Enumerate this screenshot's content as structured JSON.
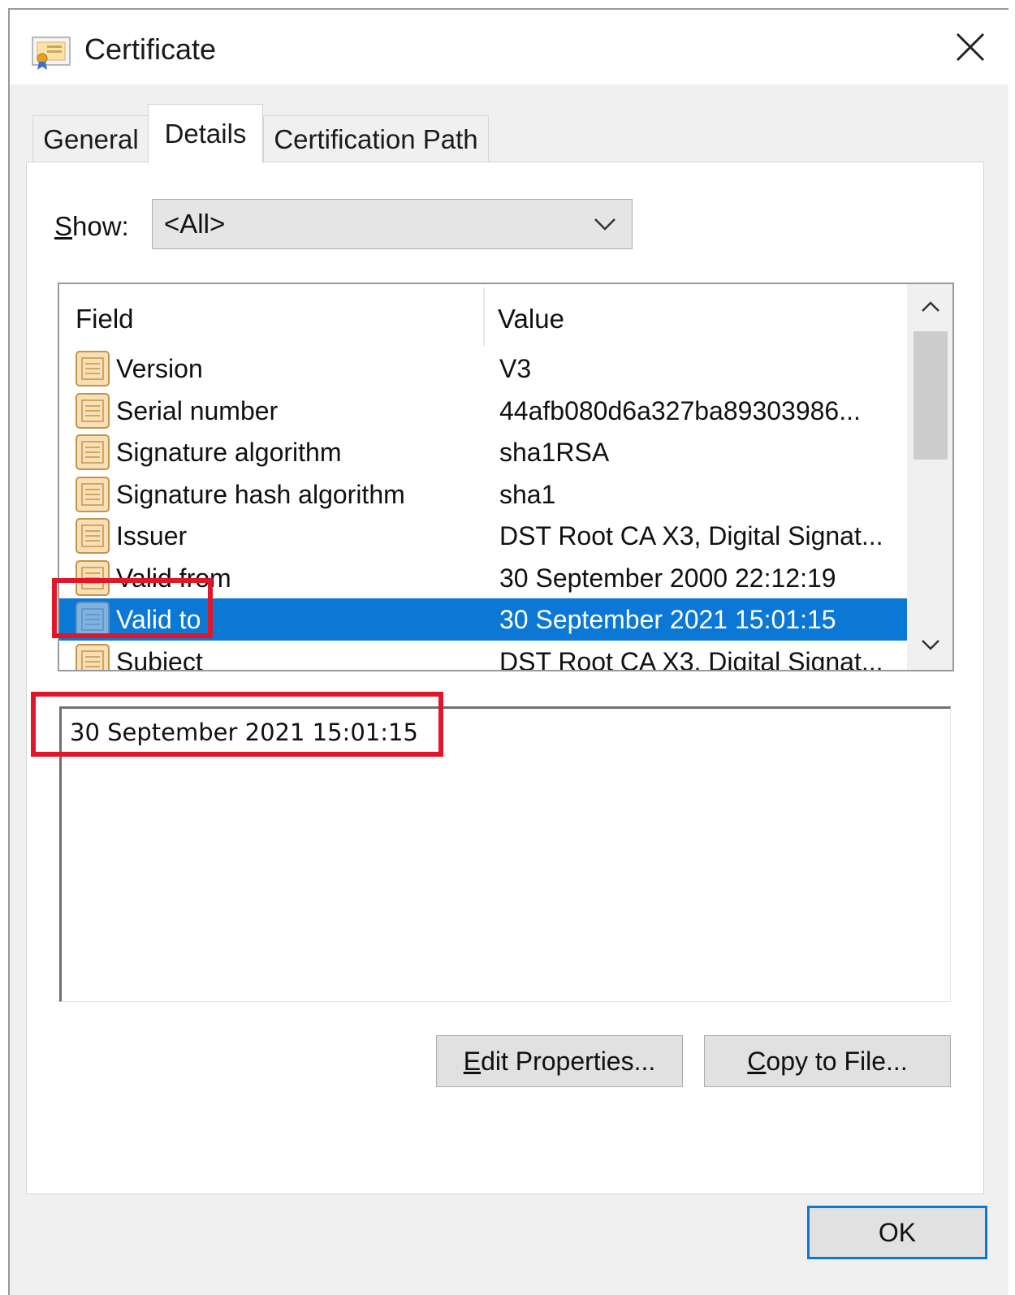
{
  "window": {
    "title": "Certificate",
    "icon": "certificate-icon",
    "close_icon": "close-icon"
  },
  "tabs": [
    {
      "label": "General",
      "active": false
    },
    {
      "label": "Details",
      "active": true
    },
    {
      "label": "Certification Path",
      "active": false
    }
  ],
  "show": {
    "label_accel": "S",
    "label_rest": "how:",
    "selected": "<All>"
  },
  "list": {
    "columns": {
      "field": "Field",
      "value": "Value"
    },
    "rows": [
      {
        "field": "Version",
        "value": "V3"
      },
      {
        "field": "Serial number",
        "value": "44afb080d6a327ba89303986..."
      },
      {
        "field": "Signature algorithm",
        "value": "sha1RSA"
      },
      {
        "field": "Signature hash algorithm",
        "value": "sha1"
      },
      {
        "field": "Issuer",
        "value": "DST Root CA X3, Digital Signat..."
      },
      {
        "field": "Valid from",
        "value": "30 September 2000 22:12:19"
      },
      {
        "field": "Valid to",
        "value": "30 September 2021 15:01:15"
      },
      {
        "field": "Subject",
        "value": "DST Root CA X3, Digital Signat..."
      }
    ],
    "selected_index": 6
  },
  "detail": {
    "text": "30 September 2021 15:01:15"
  },
  "buttons": {
    "edit_accel": "E",
    "edit_rest": "dit Properties...",
    "copy_accel": "C",
    "copy_rest": "opy to File...",
    "ok": "OK"
  },
  "colors": {
    "selection": "#0c78d6",
    "annotation": "#e0162b",
    "icon_fill": "#f7dfb6",
    "icon_stroke": "#c9924a"
  }
}
